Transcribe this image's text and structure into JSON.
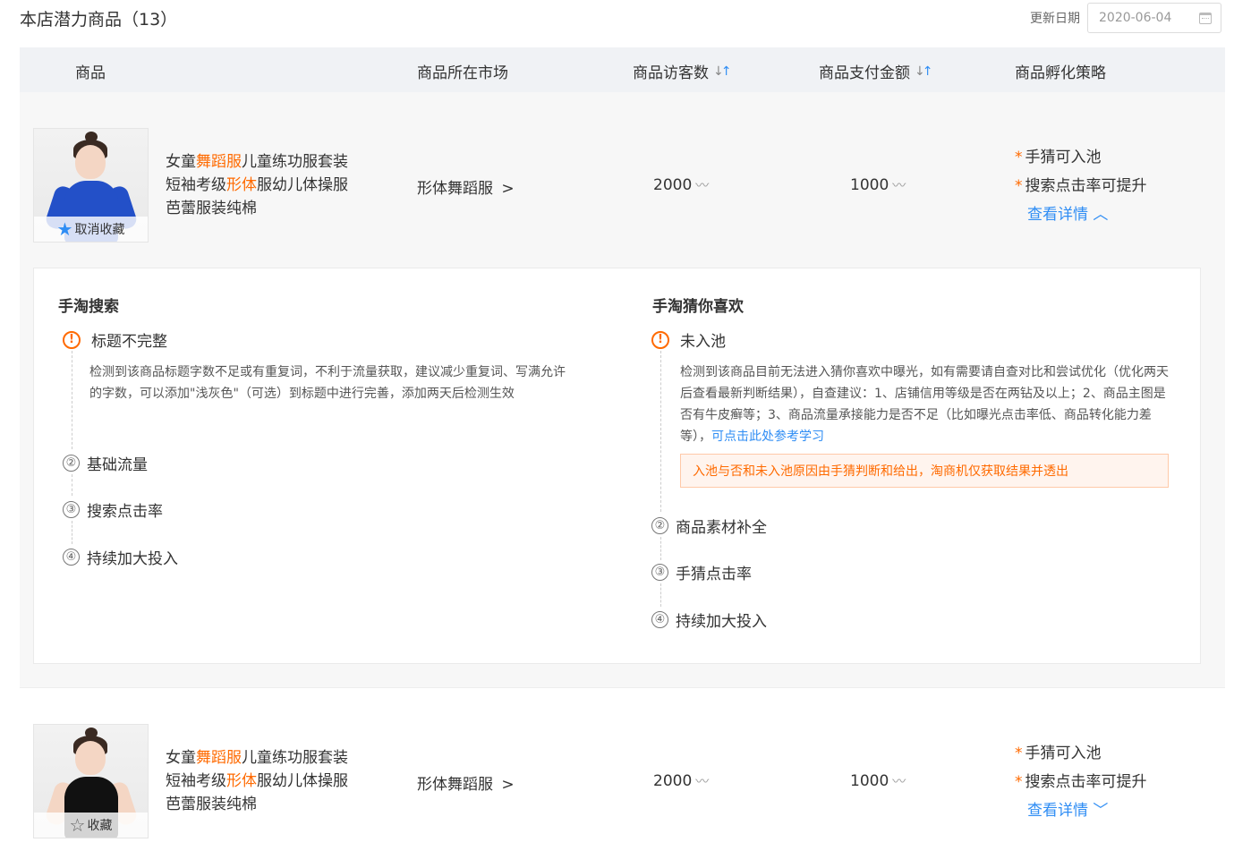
{
  "header": {
    "title": "本店潜力商品（13）",
    "date_label": "更新日期",
    "date_value": "2020-06-04"
  },
  "table": {
    "columns": [
      "商品",
      "商品所在市场",
      "商品访客数",
      "商品支付金额",
      "商品孵化策略"
    ]
  },
  "rows": [
    {
      "name_parts": [
        "女童",
        "舞蹈服",
        "儿童练功服套装短袖考级",
        "形体",
        "服幼儿体操服芭蕾服装纯棉"
      ],
      "fav_label": "取消收藏",
      "market": "形体舞蹈服",
      "visitors": "2000",
      "payment": "1000",
      "strategy": [
        "手猜可入池",
        "搜索点击率可提升"
      ],
      "detail_link": "查看详情",
      "outfit_color": "#2350c8"
    },
    {
      "name_parts": [
        "女童",
        "舞蹈服",
        "儿童练功服套装短袖考级",
        "形体",
        "服幼儿体操服芭蕾服装纯棉"
      ],
      "fav_label": "收藏",
      "market": "形体舞蹈服",
      "visitors": "2000",
      "payment": "1000",
      "strategy": [
        "手猜可入池",
        "搜索点击率可提升"
      ],
      "detail_link": "查看详情",
      "outfit_color": "#111111"
    }
  ],
  "detail": {
    "left": {
      "title": "手淘搜索",
      "steps": [
        "标题不完整",
        "基础流量",
        "搜索点击率",
        "持续加大投入"
      ],
      "step_numbers": [
        "!",
        "②",
        "③",
        "④"
      ],
      "desc": "检测到该商品标题字数不足或有重复词，不利于流量获取，建议减少重复词、写满允许的字数，可以添加\"浅灰色\"（可选）到标题中进行完善，添加两天后检测生效"
    },
    "right": {
      "title": "手淘猜你喜欢",
      "steps": [
        "未入池",
        "商品素材补全",
        "手猜点击率",
        "持续加大投入"
      ],
      "step_numbers": [
        "!",
        "②",
        "③",
        "④"
      ],
      "desc": "检测到该商品目前无法进入猜你喜欢中曝光，如有需要请自查对比和尝试优化（优化两天后查看最新判断结果），自查建议：1、店铺信用等级是否在两钻及以上；2、商品主图是否有牛皮癣等；3、商品流量承接能力是否不足（比如曝光点击率低、商品转化能力差等），",
      "desc_link": "可点击此处参考学习",
      "notice": "入池与否和未入池原因由手猜判断和给出，淘商机仅获取结果并透出"
    }
  },
  "icons": {
    "sort": "sort-icon",
    "trend": "trend-icon",
    "calendar": "calendar-icon",
    "chevron_right": "chevron-right-icon",
    "star_filled": "star-filled-icon",
    "star_outline": "star-outline-icon"
  },
  "colors": {
    "accent": "#2f8df4",
    "highlight": "#ff6a00",
    "header_bg": "#f0f2f5",
    "row_bg": "#f7f7f7"
  }
}
